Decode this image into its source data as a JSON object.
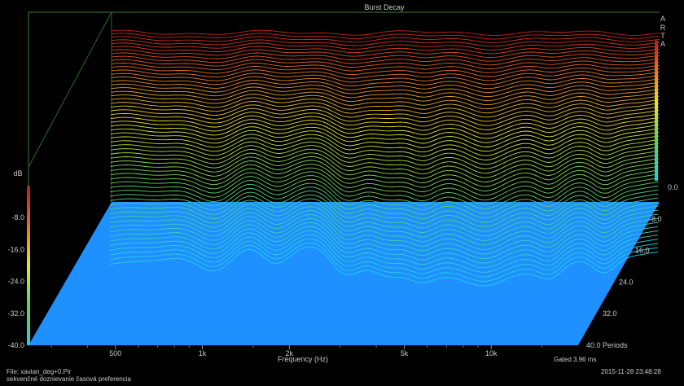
{
  "chart_data": {
    "type": "waterfall-3d",
    "title": "Burst Decay",
    "xlabel": "Frequency (Hz)",
    "x_scale": "log",
    "x_ticks": [
      "500",
      "1k",
      "2k",
      "5k",
      "10k"
    ],
    "x_tick_values": [
      500,
      1000,
      2000,
      5000,
      10000
    ],
    "xlim": [
      250,
      20000
    ],
    "z_label_unit": "Periods",
    "z_ticks": [
      "0.0",
      "8.0",
      "16.0",
      "24.0",
      "32.0",
      "40.0 Periods"
    ],
    "z_tick_values": [
      0,
      8,
      16,
      24,
      32,
      40
    ],
    "ylabel": "dB",
    "color_scale_ticks": [
      "-8.0",
      "-16.0",
      "-24.0",
      "-32.0",
      "-40.0"
    ],
    "color_scale_values": [
      -8,
      -16,
      -24,
      -32,
      -40
    ],
    "ylim": [
      -40,
      0
    ],
    "colors": [
      "#cc2020",
      "#e85a20",
      "#f5b020",
      "#e8e820",
      "#60d060",
      "#20d0e8",
      "#1e90ff"
    ],
    "floor_color": "#1e90ff",
    "series_count": 60,
    "brand": "A R T A"
  },
  "footer": {
    "file_line": "File: xavian_deg+0.Pir",
    "desc_line": "sekvenčné doznievanie časová  preferencia",
    "gated": "Gated 3.96 ms",
    "timestamp": "2015-11-28  23:48:28"
  }
}
